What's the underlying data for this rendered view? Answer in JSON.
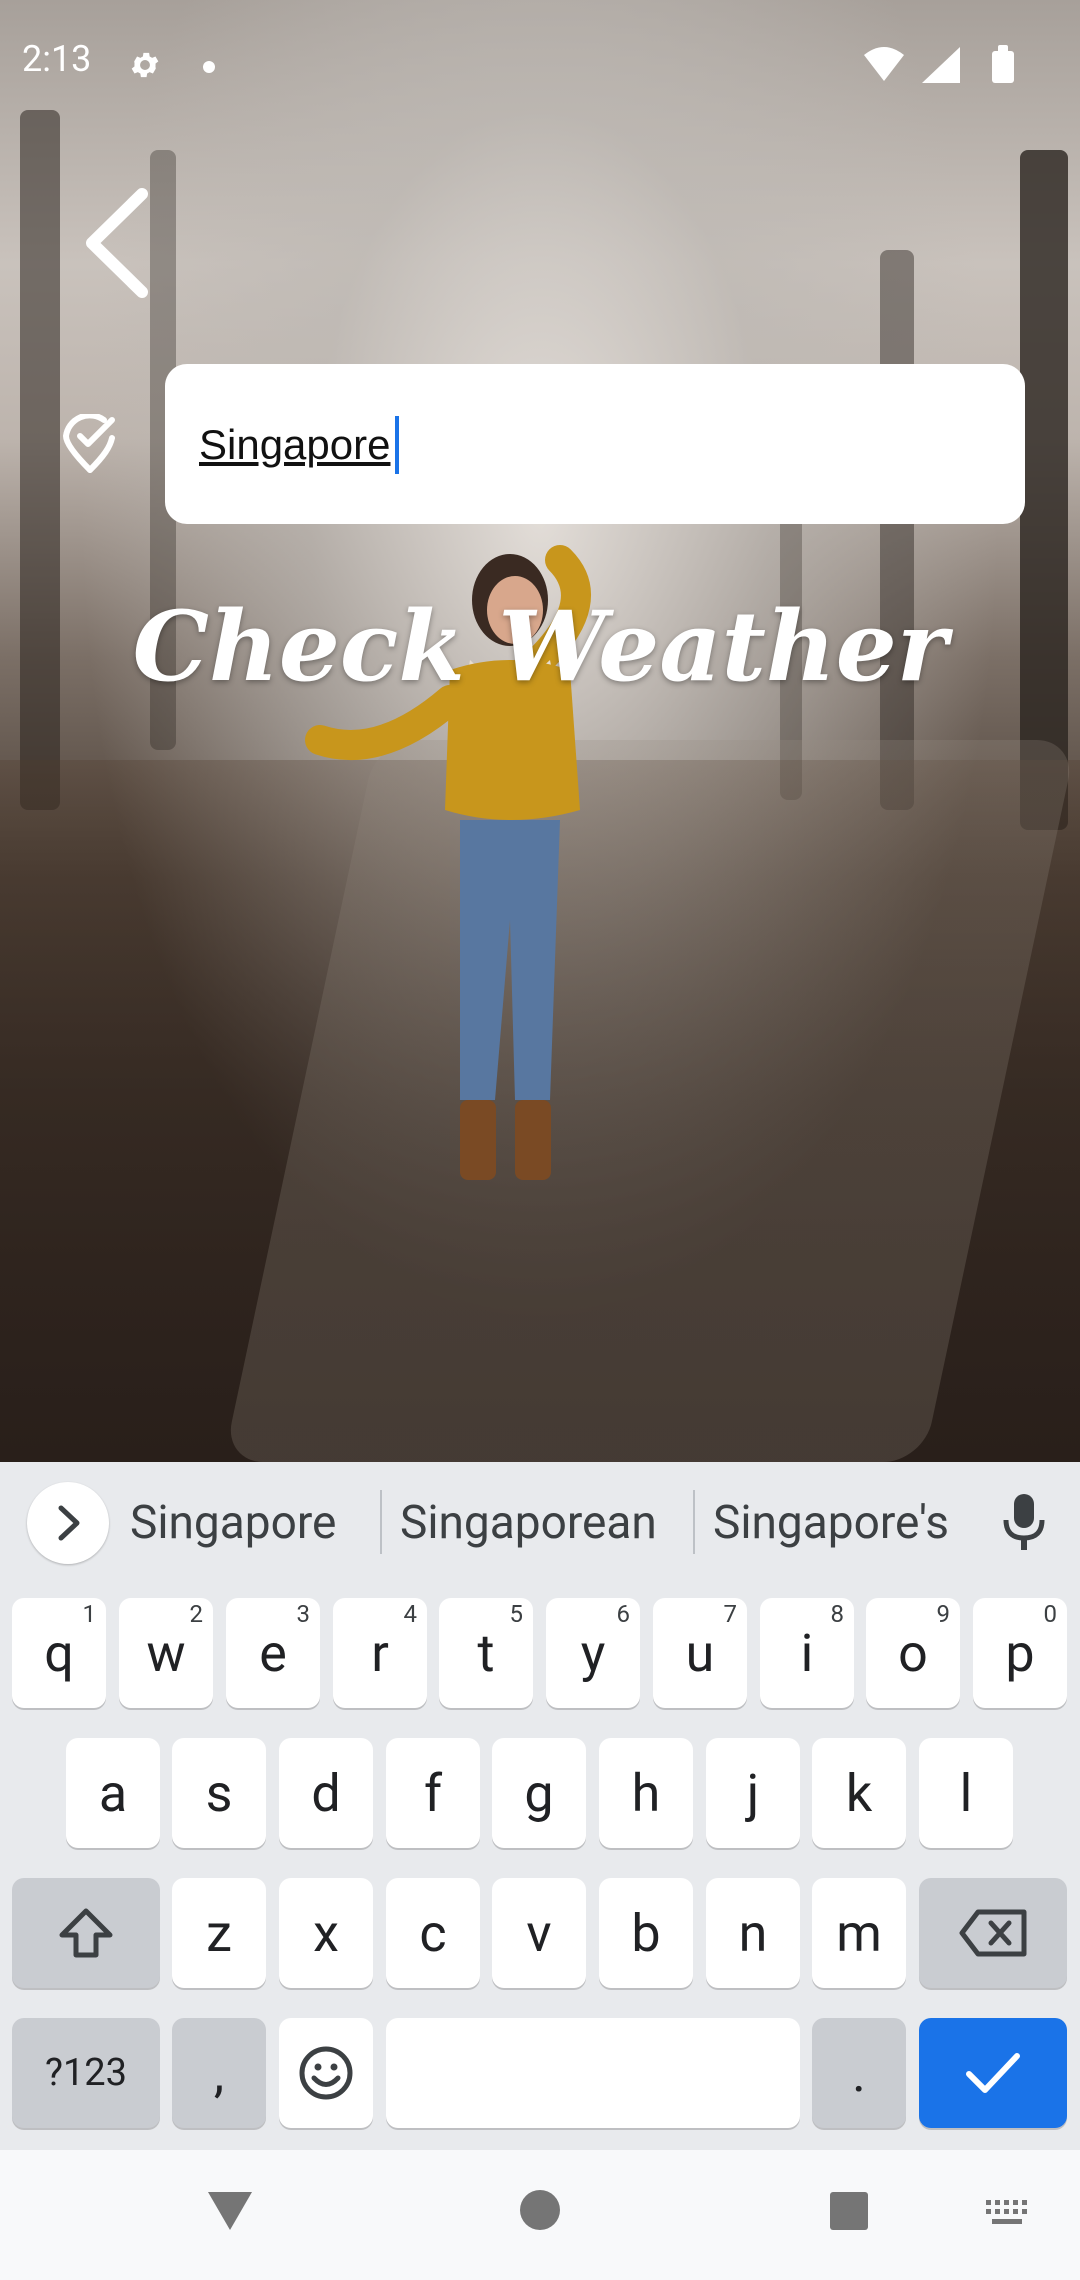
{
  "status_bar": {
    "time": "2:13",
    "settings_icon": "gear-icon",
    "notification_dot": "dot-icon",
    "wifi_icon": "wifi-icon",
    "signal_icon": "signal-icon",
    "battery_icon": "battery-icon"
  },
  "header": {
    "back_icon": "chevron-left-icon",
    "location_icon": "location-check-icon"
  },
  "search": {
    "value": "Singapore"
  },
  "main": {
    "title": "Check Weather"
  },
  "keyboard": {
    "suggestions": [
      "Singapore",
      "Singaporean",
      "Singapore's"
    ],
    "rows": [
      [
        {
          "label": "q",
          "hint": "1"
        },
        {
          "label": "w",
          "hint": "2"
        },
        {
          "label": "e",
          "hint": "3"
        },
        {
          "label": "r",
          "hint": "4"
        },
        {
          "label": "t",
          "hint": "5"
        },
        {
          "label": "y",
          "hint": "6"
        },
        {
          "label": "u",
          "hint": "7"
        },
        {
          "label": "i",
          "hint": "8"
        },
        {
          "label": "o",
          "hint": "9"
        },
        {
          "label": "p",
          "hint": "0"
        }
      ],
      [
        {
          "label": "a"
        },
        {
          "label": "s"
        },
        {
          "label": "d"
        },
        {
          "label": "f"
        },
        {
          "label": "g"
        },
        {
          "label": "h"
        },
        {
          "label": "j"
        },
        {
          "label": "k"
        },
        {
          "label": "l"
        }
      ],
      [
        {
          "label": "z"
        },
        {
          "label": "x"
        },
        {
          "label": "c"
        },
        {
          "label": "v"
        },
        {
          "label": "b"
        },
        {
          "label": "n"
        },
        {
          "label": "m"
        }
      ]
    ],
    "symbols_label": "?123",
    "comma_label": ",",
    "period_label": ".",
    "enter_color": "#1a73e8"
  },
  "nav_bar": {
    "back_icon": "triangle-back-icon",
    "home_icon": "circle-home-icon",
    "recents_icon": "square-recents-icon",
    "keyboard_icon": "keyboard-icon"
  }
}
